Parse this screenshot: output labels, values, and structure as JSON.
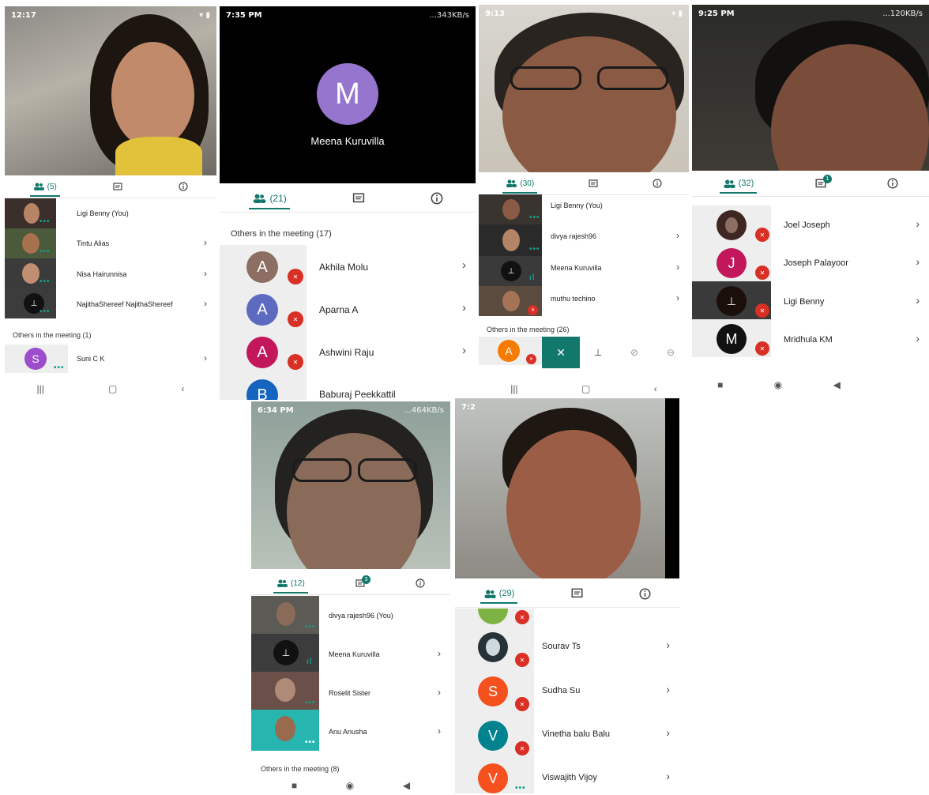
{
  "colors": {
    "teal": "#12786b",
    "mute_red": "#d93025"
  },
  "shots": {
    "s1": {
      "time": "12:17",
      "people_count": "(5)",
      "participants": [
        "Ligi Benny (You)",
        "Tintu Alias",
        "Nisa Hairunnisa",
        "NajithaShereef NajithaShereef"
      ],
      "others_label": "Others in the meeting (1)",
      "other_initial": "S",
      "other_name": "Suni C K"
    },
    "s2": {
      "time": "7:35 PM",
      "status_right": "...343KB/s",
      "speaker_initial": "M",
      "speaker_name": "Meena Kuruvilla",
      "people_count": "(21)",
      "others_label": "Others in the meeting (17)",
      "participants": [
        {
          "initial": "A",
          "name": "Akhila Molu",
          "color": "#8d6e63"
        },
        {
          "initial": "A",
          "name": "Aparna A",
          "color": "#5c6bc0"
        },
        {
          "initial": "A",
          "name": "Ashwini Raju",
          "color": "#c2185b"
        },
        {
          "initial": "B",
          "name": "Baburaj Peekkattil",
          "color": "#1565c0"
        }
      ]
    },
    "s3": {
      "time": "9:13",
      "people_count": "(30)",
      "participants": [
        "Ligi Benny (You)",
        "divya rajesh96",
        "Meena Kuruvilla",
        "muthu techino"
      ],
      "others_label": "Others in the meeting (26)",
      "other_initial": "A"
    },
    "s4": {
      "time": "9:25 PM",
      "status_right": "...120KB/s",
      "people_count": "(32)",
      "chat_badge": "1",
      "participants": [
        {
          "initial": "",
          "name": "Joel Joseph",
          "color": "#3e2723"
        },
        {
          "initial": "J",
          "name": "Joseph Palayoor",
          "color": "#c2185b"
        },
        {
          "initial": "",
          "name": "Ligi Benny",
          "color": "#111111"
        },
        {
          "initial": "M",
          "name": "Mridhula KM",
          "color": "#1b5e20"
        }
      ]
    },
    "s5": {
      "time": "6:34 PM",
      "status_right": "...464KB/s",
      "people_count": "(12)",
      "chat_badge": "3",
      "participants": [
        "divya rajesh96 (You)",
        "Meena Kuruvilla",
        "Roselit Sister",
        "Anu Anusha"
      ],
      "others_label": "Others in the meeting (8)"
    },
    "s6": {
      "time": "7:2",
      "people_count": "(29)",
      "participants": [
        {
          "initial": "",
          "name": "Sourav Ts",
          "color": "#263238"
        },
        {
          "initial": "S",
          "name": "Sudha Su",
          "color": "#f4511e"
        },
        {
          "initial": "V",
          "name": "Vinetha balu Balu",
          "color": "#00838f"
        },
        {
          "initial": "V",
          "name": "Viswajith Vijoy",
          "color": "#f4511e"
        }
      ]
    }
  }
}
